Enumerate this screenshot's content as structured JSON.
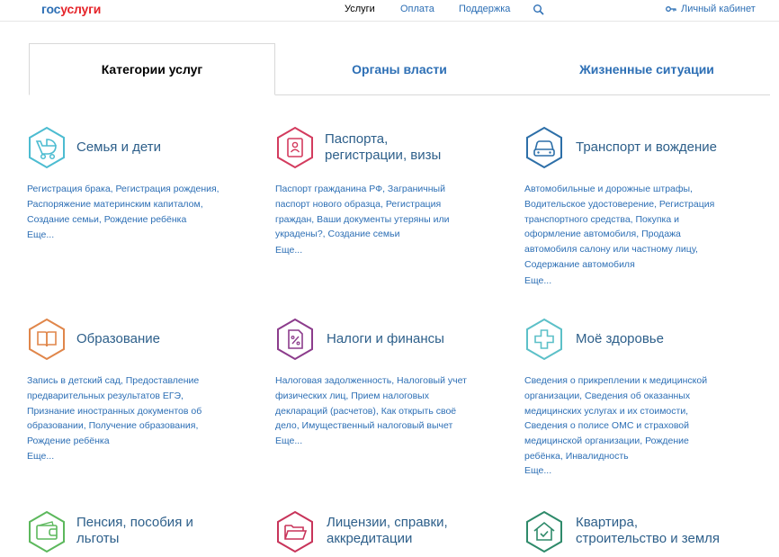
{
  "header": {
    "logo_part1": "гос",
    "logo_part2": "услуги",
    "nav": [
      "Услуги",
      "Оплата",
      "Поддержка"
    ],
    "cabinet": "Личный кабинет"
  },
  "tabs": [
    "Категории услуг",
    "Органы власти",
    "Жизненные ситуации"
  ],
  "categories": [
    {
      "title_lines": [
        "Семья и дети"
      ],
      "links": "Регистрация брака, Регистрация рождения, Распоряжение материнским капиталом, Создание семьи, Рождение ребёнка",
      "more": "Еще...",
      "icon": "stroller-icon",
      "color": "#4cbcd1"
    },
    {
      "title_lines": [
        "Паспорта,",
        "регистрации, визы"
      ],
      "links": "Паспорт гражданина РФ, Заграничный паспорт нового образца, Регистрация граждан, Ваши документы утеряны или украдены?, Создание семьи",
      "more": "Еще...",
      "icon": "passport-icon",
      "color": "#d33b5e"
    },
    {
      "title_lines": [
        "Транспорт и вождение"
      ],
      "links": "Автомобильные и дорожные штрафы, Водительское удостоверение, Регистрация транспортного средства, Покупка и оформление автомобиля, Продажа автомобиля салону или частному лицу, Содержание автомобиля",
      "more": "Еще...",
      "icon": "car-icon",
      "color": "#2d6fa8"
    },
    {
      "title_lines": [
        "Образование"
      ],
      "links": "Запись в детский сад, Предоставление предварительных результатов ЕГЭ, Признание иностранных документов об образовании, Получение образования, Рождение ребёнка",
      "more": "Еще...",
      "icon": "book-icon",
      "color": "#e0864a"
    },
    {
      "title_lines": [
        "Налоги и финансы"
      ],
      "links": "Налоговая задолженность, Налоговый учет физических лиц, Прием налоговых деклараций (расчетов), Как открыть своё дело, Имущественный налоговый вычет",
      "more": "Еще...",
      "icon": "tax-document-icon",
      "color": "#8c3c8c"
    },
    {
      "title_lines": [
        "Моё здоровье"
      ],
      "links": "Сведения о прикреплении к медицинской организации, Сведения об оказанных медицинских услугах и их стоимости, Сведения о полисе ОМС и страховой медицинской организации, Рождение ребёнка, Инвалидность",
      "more": "Еще...",
      "icon": "medical-cross-icon",
      "color": "#5cc0c8"
    },
    {
      "title_lines": [
        "Пенсия, пособия и",
        "льготы"
      ],
      "links": "",
      "more": "",
      "icon": "wallet-icon",
      "color": "#5cb85c"
    },
    {
      "title_lines": [
        "Лицензии, справки,",
        "аккредитации"
      ],
      "links": "",
      "more": "",
      "icon": "folder-icon",
      "color": "#c8345a"
    },
    {
      "title_lines": [
        "Квартира,",
        "строительство и земля"
      ],
      "links": "",
      "more": "",
      "icon": "house-check-icon",
      "color": "#2e8a6a"
    }
  ]
}
